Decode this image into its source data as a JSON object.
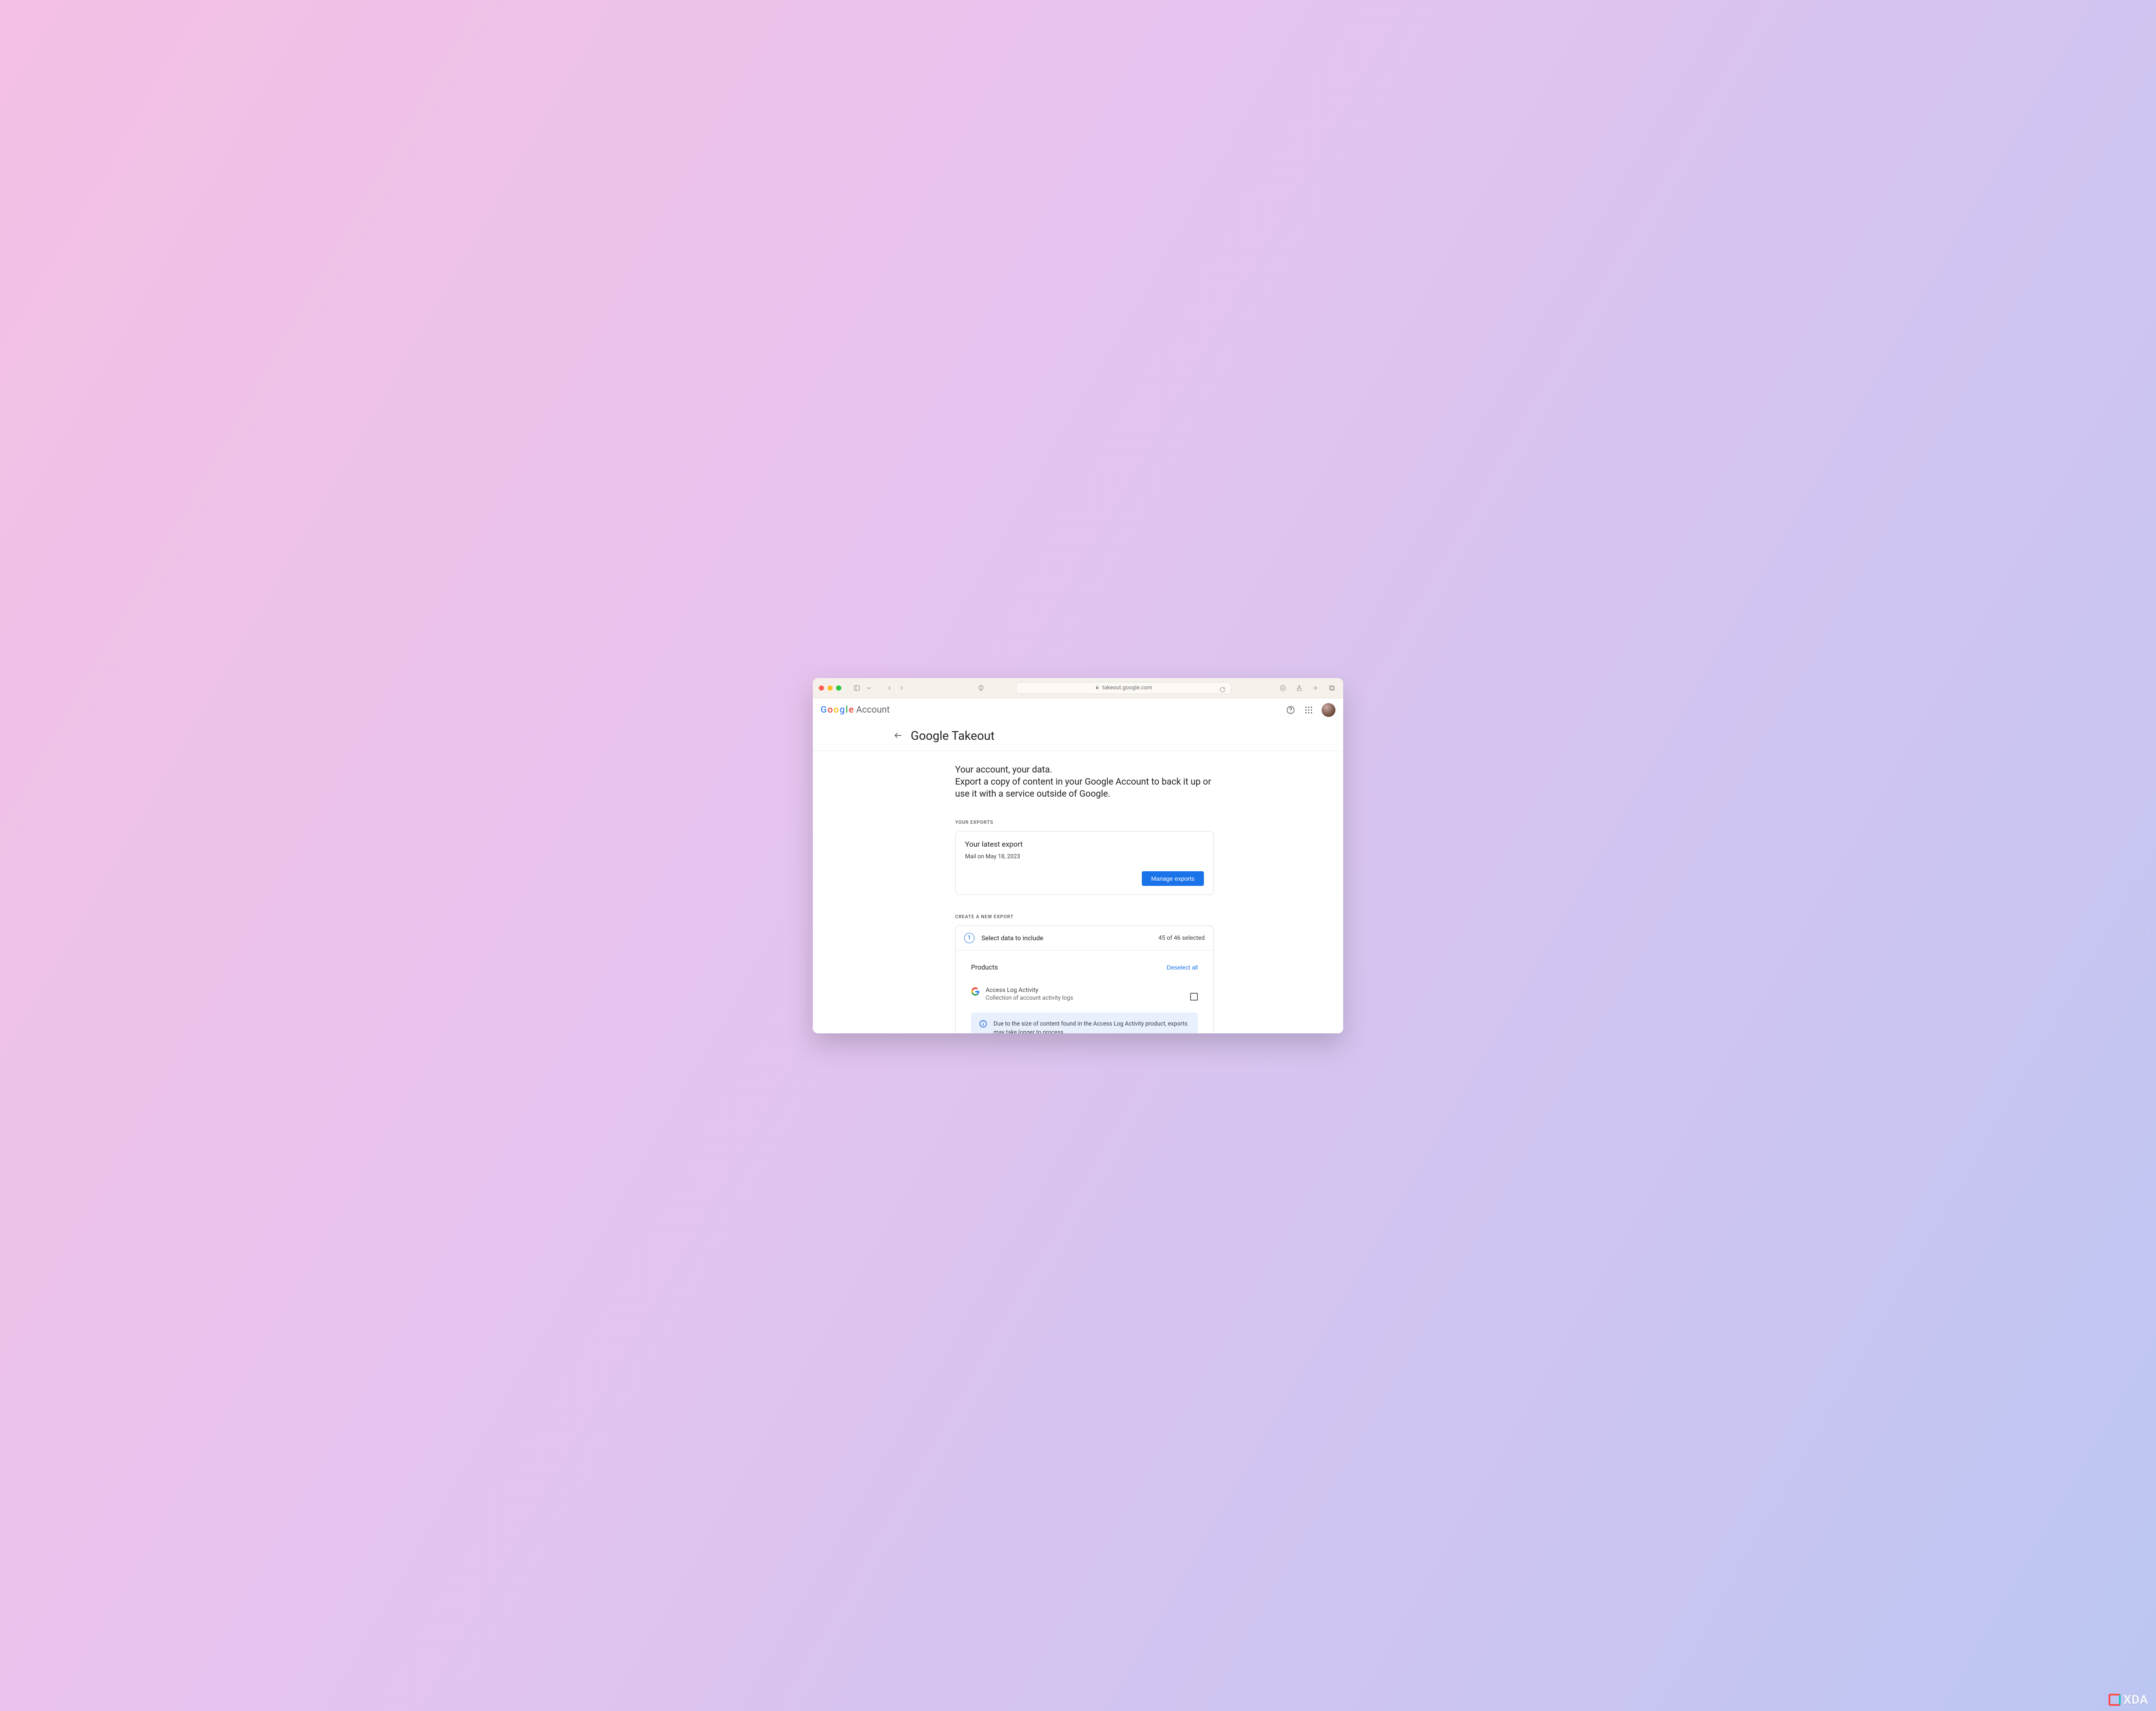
{
  "browser": {
    "address": "takeout.google.com"
  },
  "brand": {
    "name_parts": [
      "G",
      "o",
      "o",
      "g",
      "l",
      "e"
    ],
    "suffix": "Account"
  },
  "page": {
    "title": "Google Takeout",
    "intro_line1": "Your account, your data.",
    "intro_line2": "Export a copy of content in your Google Account to back it up or use it with a service outside of Google."
  },
  "exports": {
    "section_label": "YOUR EXPORTS",
    "latest_title": "Your latest export",
    "latest_detail": "Mail on May 18, 2023",
    "manage_button": "Manage exports"
  },
  "new_export": {
    "section_label": "CREATE A NEW EXPORT",
    "step_number": "1",
    "step_title": "Select data to include",
    "selected_count": "45 of 46 selected",
    "products_heading": "Products",
    "deselect_label": "Deselect all",
    "product": {
      "name": "Access Log Activity",
      "description": "Collection of account activity logs",
      "checked": false
    },
    "info_message": "Due to the size of content found in the Access Log Activity product, exports may take longer to process."
  },
  "watermark": "XDA"
}
